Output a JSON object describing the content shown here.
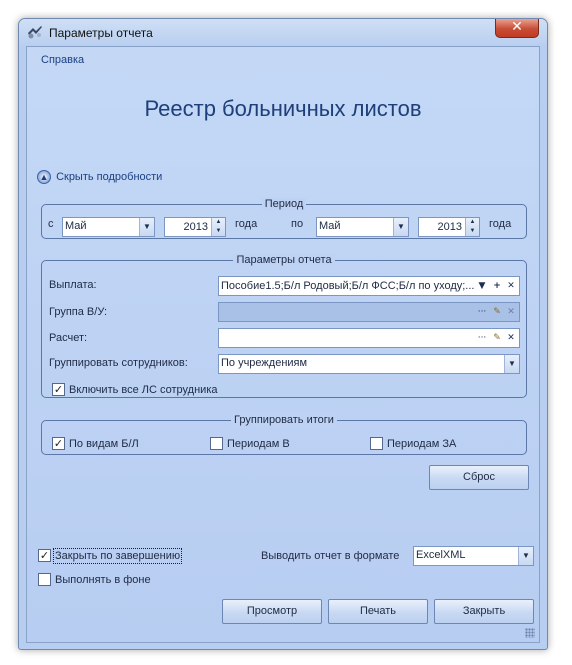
{
  "window": {
    "title": "Параметры отчета",
    "close_glyph": "✕"
  },
  "menu": {
    "help_link": "Справка"
  },
  "report_title": "Реестр больничных листов",
  "hide_details": {
    "label": "Скрыть подробности",
    "icon": "collapse-up-icon"
  },
  "period": {
    "title": "Период",
    "from_label": "с",
    "from_month": "Май",
    "from_year": "2013",
    "year_label": "года",
    "to_label": "по",
    "to_month": "Май",
    "to_year": "2013",
    "year_label2": "года"
  },
  "params": {
    "title": "Параметры отчета",
    "payment_label": "Выплата:",
    "payment_value": "Пособие1.5;Б/л Родовый;Б/л ФСС;Б/л по уходу;...",
    "group_label": "Группа В/У:",
    "group_value": "",
    "calc_label": "Расчет:",
    "calc_value": "",
    "grouping_label": "Группировать сотрудников:",
    "grouping_value": "По учреждениям",
    "include_all_label": "Включить все ЛС сотрудника",
    "include_all_checked": true
  },
  "totals": {
    "title": "Группировать итоги",
    "by_type_label": "По видам Б/Л",
    "by_type_checked": true,
    "periods_label": "Периодам В",
    "periods_checked": false,
    "periods_za_label": "Периодам ЗА",
    "periods_za_checked": false
  },
  "reset_button": "Сброс",
  "options": {
    "close_on_finish_label": "Закрыть по завершению",
    "close_on_finish_checked": true,
    "background_label": "Выполнять в фоне",
    "background_checked": false,
    "format_label": "Выводить отчет в формате",
    "format_value": "ExcelXML"
  },
  "buttons": {
    "preview": "Просмотр",
    "print": "Печать",
    "close": "Закрыть"
  },
  "glyphs": {
    "dropdown": "▼",
    "spin": "▲▼",
    "ellipsis": "···",
    "clear": "✕",
    "add": "+",
    "check": "✓"
  },
  "colors": {
    "client_bg": "#b7cdf1",
    "title_blue": "#1f3f7a",
    "close_red": "#c84d36"
  }
}
